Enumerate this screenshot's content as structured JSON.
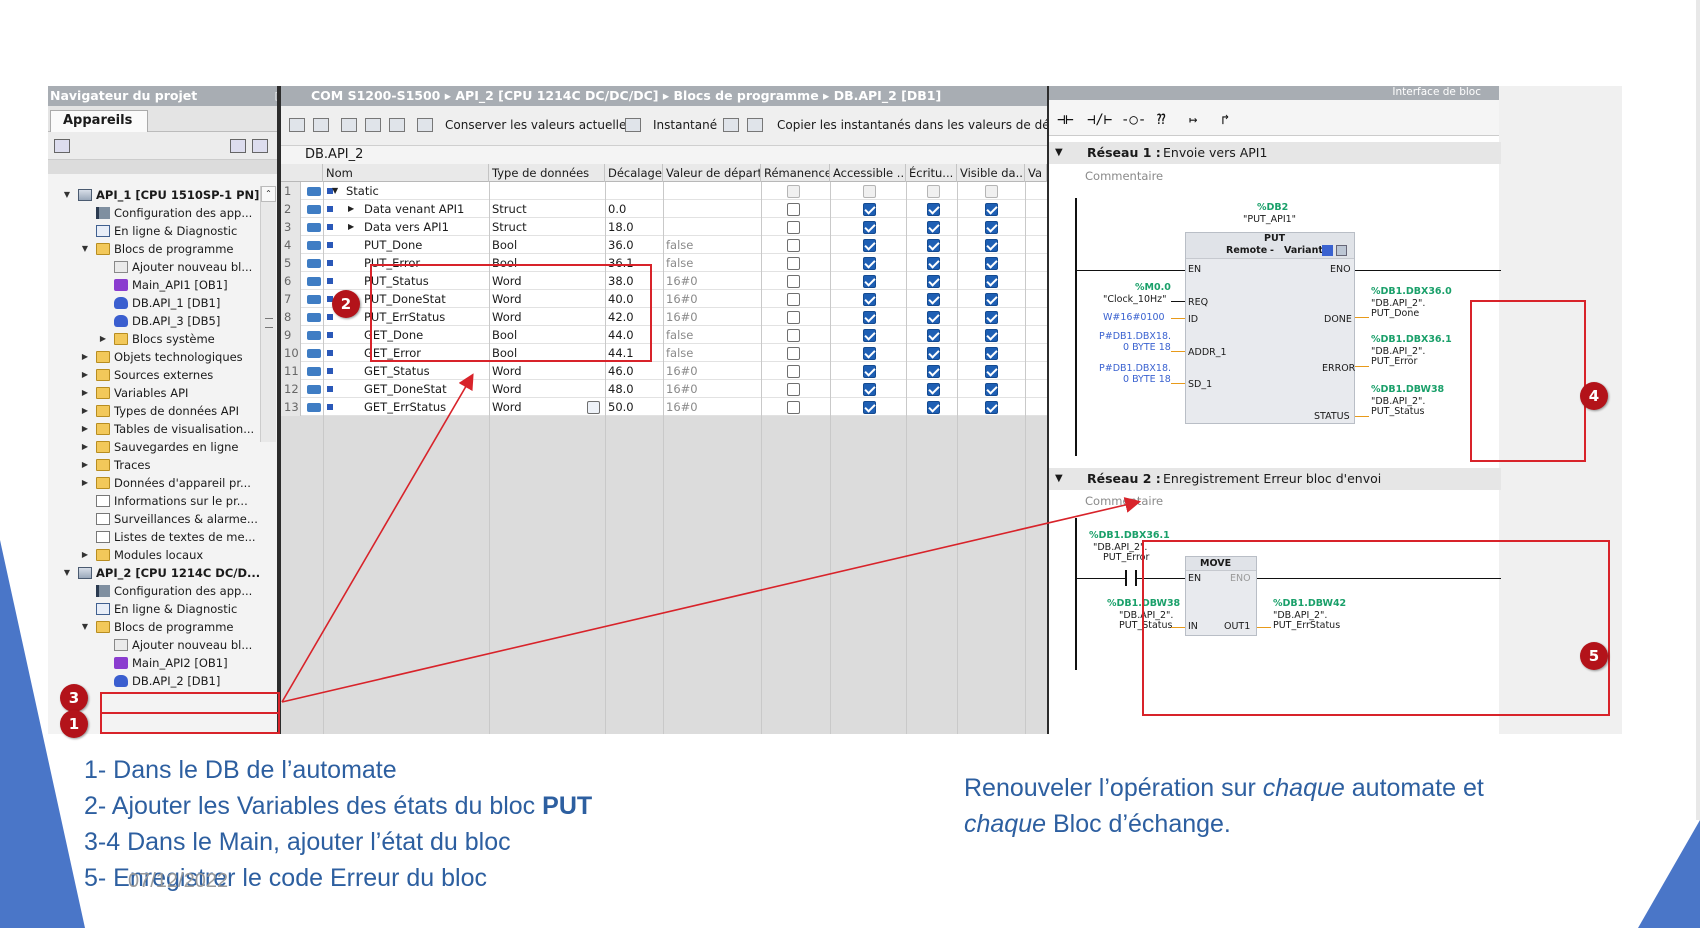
{
  "navigator": {
    "title": "Navigateur du projet",
    "tab": "Appareils",
    "tree": [
      {
        "label": "API_1 [CPU 1510SP-1 PN]",
        "icon": "cpu-icon"
      },
      {
        "label": "Configuration des app...",
        "icon": "device-config-icon"
      },
      {
        "label": "En ligne & Diagnostic",
        "icon": "diagnostic-icon"
      },
      {
        "label": "Blocs de programme",
        "icon": "folder-icon"
      },
      {
        "label": "Ajouter nouveau bl...",
        "icon": "add-block-icon"
      },
      {
        "label": "Main_API1 [OB1]",
        "icon": "ob-icon"
      },
      {
        "label": "DB.API_1 [DB1]",
        "icon": "db-icon"
      },
      {
        "label": "DB.API_3 [DB5]",
        "icon": "db-icon"
      },
      {
        "label": "Blocs système",
        "icon": "folder-icon"
      },
      {
        "label": "Objets technologiques",
        "icon": "folder-icon"
      },
      {
        "label": "Sources externes",
        "icon": "folder-icon"
      },
      {
        "label": "Variables API",
        "icon": "folder-icon"
      },
      {
        "label": "Types de données API",
        "icon": "folder-icon"
      },
      {
        "label": "Tables de visualisation...",
        "icon": "folder-icon"
      },
      {
        "label": "Sauvegardes en ligne",
        "icon": "folder-icon"
      },
      {
        "label": "Traces",
        "icon": "folder-icon"
      },
      {
        "label": "Données d'appareil pr...",
        "icon": "folder-icon"
      },
      {
        "label": "Informations sur le pr...",
        "icon": "document-icon"
      },
      {
        "label": "Surveillances & alarme...",
        "icon": "document-icon"
      },
      {
        "label": "Listes de textes de me...",
        "icon": "document-icon"
      },
      {
        "label": "Modules locaux",
        "icon": "folder-icon"
      },
      {
        "label": "API_2 [CPU 1214C DC/D...",
        "icon": "cpu-icon"
      },
      {
        "label": "Configuration des app...",
        "icon": "device-config-icon"
      },
      {
        "label": "En ligne & Diagnostic",
        "icon": "diagnostic-icon"
      },
      {
        "label": "Blocs de programme",
        "icon": "folder-icon"
      },
      {
        "label": "Ajouter nouveau bl...",
        "icon": "add-block-icon"
      },
      {
        "label": "Main_API2 [OB1]",
        "icon": "ob-icon"
      },
      {
        "label": "DB.API_2 [DB1]",
        "icon": "db-icon"
      }
    ]
  },
  "editor": {
    "breadcrumb": [
      "COM S1200-S1500",
      "API_2 [CPU 1214C DC/DC/DC]",
      "Blocs de programme",
      "DB.API_2 [DB1]"
    ],
    "toolbar": {
      "keep_values": "Conserver les valeurs actuelles",
      "snapshot": "Instantané",
      "copy_snapshots": "Copier les instantanés dans les valeurs de départ"
    },
    "db_name": "DB.API_2",
    "columns": [
      "Nom",
      "Type de données",
      "Décalage",
      "Valeur de départ",
      "Rémanence",
      "Accessible ...",
      "Écritu...",
      "Visible da...",
      "Va"
    ],
    "rows": [
      {
        "n": "1",
        "name": "Static",
        "type": "",
        "offset": "",
        "start": ""
      },
      {
        "n": "2",
        "name": "Data venant API1",
        "type": "Struct",
        "offset": "0.0",
        "start": ""
      },
      {
        "n": "3",
        "name": "Data vers API1",
        "type": "Struct",
        "offset": "18.0",
        "start": ""
      },
      {
        "n": "4",
        "name": "PUT_Done",
        "type": "Bool",
        "offset": "36.0",
        "start": "false"
      },
      {
        "n": "5",
        "name": "PUT_Error",
        "type": "Bool",
        "offset": "36.1",
        "start": "false"
      },
      {
        "n": "6",
        "name": "PUT_Status",
        "type": "Word",
        "offset": "38.0",
        "start": "16#0"
      },
      {
        "n": "7",
        "name": "PUT_DoneStat",
        "type": "Word",
        "offset": "40.0",
        "start": "16#0"
      },
      {
        "n": "8",
        "name": "PUT_ErrStatus",
        "type": "Word",
        "offset": "42.0",
        "start": "16#0"
      },
      {
        "n": "9",
        "name": "GET_Done",
        "type": "Bool",
        "offset": "44.0",
        "start": "false"
      },
      {
        "n": "10",
        "name": "GET_Error",
        "type": "Bool",
        "offset": "44.1",
        "start": "false"
      },
      {
        "n": "11",
        "name": "GET_Status",
        "type": "Word",
        "offset": "46.0",
        "start": "16#0"
      },
      {
        "n": "12",
        "name": "GET_DoneStat",
        "type": "Word",
        "offset": "48.0",
        "start": "16#0"
      },
      {
        "n": "13",
        "name": "GET_ErrStatus",
        "type": "Word",
        "offset": "50.0",
        "start": "16#0"
      }
    ]
  },
  "ladder": {
    "header": "Interface de bloc",
    "toolbar": [
      "⊣⊢",
      "⊣/⊢",
      "-○-",
      "⁇",
      "↦",
      "↱"
    ],
    "net1": {
      "title": "Réseau 1 :",
      "desc": "Envoie vers API1",
      "comment": "Commentaire",
      "db_addr": "%DB2",
      "db_sym": "\"PUT_API1\"",
      "block": "PUT",
      "remote": "Remote",
      "dash": "-",
      "variant": "Variant",
      "pins": {
        "en": "EN",
        "eno": "ENO",
        "req": "REQ",
        "id": "ID",
        "addr": "ADDR_1",
        "sd": "SD_1",
        "done": "DONE",
        "error": "ERROR",
        "status": "STATUS"
      },
      "req_addr": "%M0.0",
      "req_sym": "\"Clock_10Hz\"",
      "id_val": "W#16#0100",
      "addr_val_1": "P#DB1.DBX18.",
      "addr_val_2": "0 BYTE 18",
      "sd_val_1": "P#DB1.DBX18.",
      "sd_val_2": "0 BYTE 18",
      "done_addr": "%DB1.DBX36.0",
      "done_sym_1": "\"DB.API_2\".",
      "done_sym_2": "PUT_Done",
      "error_addr": "%DB1.DBX36.1",
      "error_sym_1": "\"DB.API_2\".",
      "error_sym_2": "PUT_Error",
      "status_addr": "%DB1.DBW38",
      "status_sym_1": "\"DB.API_2\".",
      "status_sym_2": "PUT_Status"
    },
    "net2": {
      "title": "Réseau 2 :",
      "desc": "Enregistrement Erreur bloc d'envoi",
      "comment": "Commentaire",
      "contact_addr": "%DB1.DBX36.1",
      "contact_sym_1": "\"DB.API_2\".",
      "contact_sym_2": "PUT_Error",
      "block": "MOVE",
      "pins": {
        "en": "EN",
        "eno": "ENO",
        "in": "IN",
        "out": "OUT1"
      },
      "in_addr": "%DB1.DBW38",
      "in_sym_1": "\"DB.API_2\".",
      "in_sym_2": "PUT_Status",
      "out_addr": "%DB1.DBW42",
      "out_sym_1": "\"DB.API_2\".",
      "out_sym_2": "PUT_ErrStatus"
    }
  },
  "badges": [
    "1",
    "2",
    "3",
    "4",
    "5"
  ],
  "captions": {
    "line1": "1- Dans le DB de l’automate",
    "line2_a": "2- Ajouter les Variables des états du bloc ",
    "line2_b": "PUT",
    "line3": "3-4 Dans le Main, ajouter l’état du bloc",
    "line4": "5- Enregistrer le code Erreur du bloc",
    "right_a": "Renouveler l’opération sur ",
    "right_b": "chaque",
    "right_c": " automate et",
    "right_d": "chaque",
    "right_e": " Bloc d’échange.",
    "date": "07/12/2022"
  },
  "colors": {
    "accent": "#2d5fa0",
    "annotation_red": "#d8232a",
    "badge": "#b3131a",
    "slide_triangle": "#4a76c8"
  }
}
